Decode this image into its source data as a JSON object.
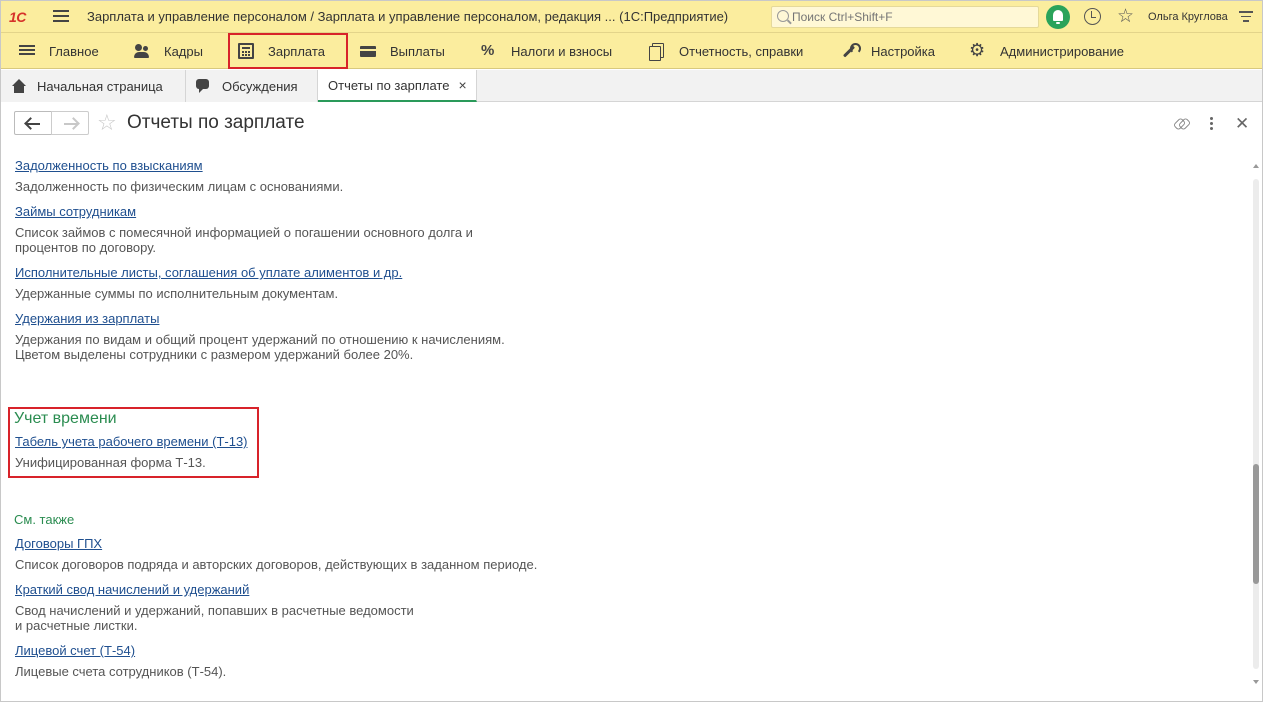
{
  "app": {
    "logo": "1С",
    "title": "Зарплата и управление персоналом / Зарплата и управление персоналом, редакция ...   (1С:Предприятие)",
    "search_placeholder": "Поиск Ctrl+Shift+F",
    "user": "Ольга Круглова"
  },
  "sections": [
    {
      "label": "Главное",
      "icon": "menu-icon"
    },
    {
      "label": "Кадры",
      "icon": "people-icon"
    },
    {
      "label": "Зарплата",
      "icon": "calculator-icon",
      "active": true
    },
    {
      "label": "Выплаты",
      "icon": "card-icon"
    },
    {
      "label": "Налоги и взносы",
      "icon": "percent-icon"
    },
    {
      "label": "Отчетность, справки",
      "icon": "documents-icon"
    },
    {
      "label": "Настройка",
      "icon": "wrench-icon"
    },
    {
      "label": "Администрирование",
      "icon": "gear-icon"
    }
  ],
  "tabs": [
    {
      "label": "Начальная страница",
      "icon": "home-icon"
    },
    {
      "label": "Обсуждения",
      "icon": "chat-icon"
    },
    {
      "label": "Отчеты по зарплате",
      "current": true
    }
  ],
  "form": {
    "title": "Отчеты по зарплате"
  },
  "reports": [
    {
      "link": "Задолженность по взысканиям",
      "desc": [
        "Задолженность по физическим лицам с основаниями."
      ]
    },
    {
      "link": "Займы сотрудникам",
      "desc": [
        "Список займов с помесячной информацией о погашении основного долга и",
        "процентов по договору."
      ]
    },
    {
      "link": "Исполнительные листы, соглашения об уплате алиментов и др.",
      "desc": [
        "Удержанные суммы по исполнительным документам."
      ]
    },
    {
      "link": "Удержания из зарплаты",
      "desc": [
        "Удержания по видам и общий процент удержаний по отношению к начислениям.",
        "Цветом выделены сотрудники с размером удержаний более 20%."
      ]
    }
  ],
  "time_group": {
    "title": "Учет времени",
    "link": "Табель учета рабочего времени (Т-13)",
    "desc": "Унифицированная форма Т-13."
  },
  "see_also": {
    "title": "См. также",
    "items": [
      {
        "link": "Договоры ГПХ",
        "desc": [
          "Список договоров подряда и авторских договоров, действующих в заданном периоде."
        ]
      },
      {
        "link": "Краткий свод начислений и удержаний",
        "desc": [
          "Свод начислений и удержаний, попавших в расчетные ведомости",
          "и расчетные листки."
        ]
      },
      {
        "link": "Лицевой счет (Т-54)",
        "desc": [
          "Лицевые счета сотрудников (Т-54)."
        ]
      }
    ]
  },
  "scroll": {
    "position": 0.77
  },
  "colors": {
    "accent": "#fbed9e",
    "group_title": "#2a8c50",
    "link": "#1f4f8f",
    "highlight": "#d8232a"
  }
}
